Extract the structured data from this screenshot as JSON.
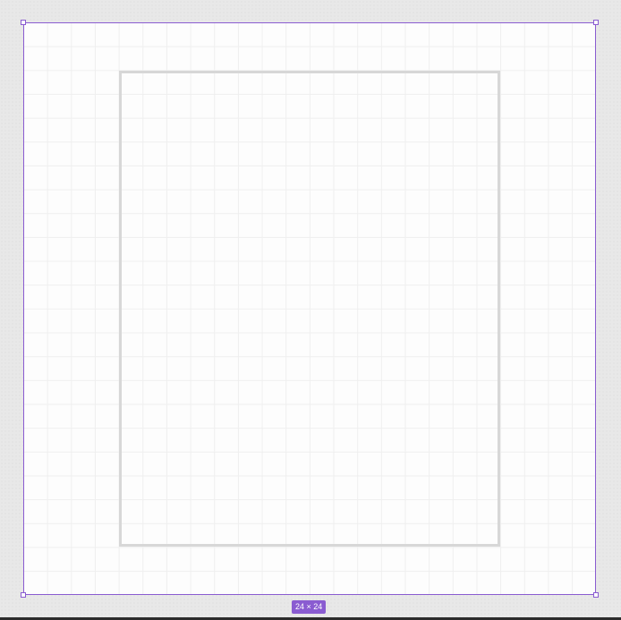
{
  "canvas": {
    "selection_color": "#8a5cd1",
    "frame_fill": "#fdfdfd",
    "shape_stroke": "#d7d7d7"
  },
  "selection": {
    "size_label": "24 × 24"
  }
}
